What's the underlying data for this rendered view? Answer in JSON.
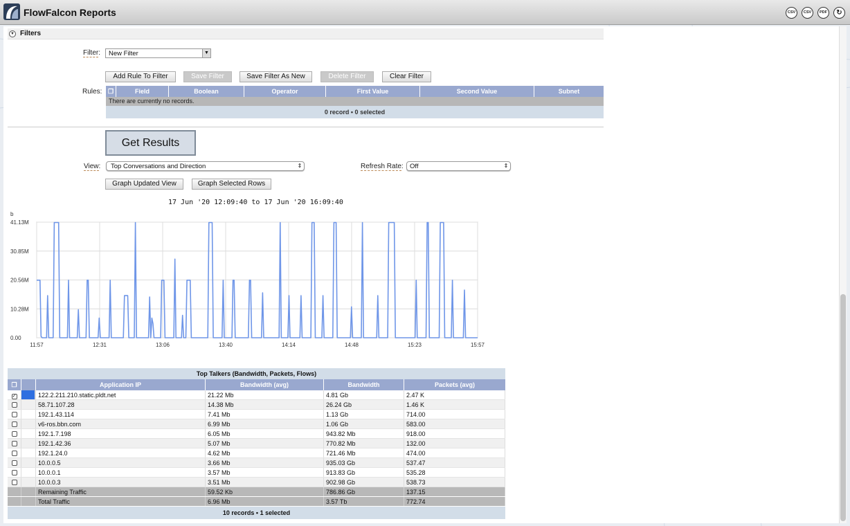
{
  "app": {
    "title": "FlowFalcon Reports",
    "header_icons": [
      {
        "name": "csv-icon",
        "label": "CSV"
      },
      {
        "name": "email-csv-icon",
        "label": "CSV"
      },
      {
        "name": "pdf-icon",
        "label": "PDF"
      },
      {
        "name": "refresh-icon",
        "label": ""
      }
    ]
  },
  "filters": {
    "section_label": "Filters",
    "filter_label": "Filter",
    "filter_value": "New Filter",
    "buttons": {
      "add_rule": "Add Rule To Filter",
      "save": "Save Filter",
      "save_as_new": "Save Filter As New",
      "delete": "Delete Filter",
      "clear": "Clear Filter"
    },
    "rules_label": "Rules:",
    "rules_columns": [
      "Field",
      "Boolean",
      "Operator",
      "First Value",
      "Second Value",
      "Subnet"
    ],
    "no_records": "There are currently no records.",
    "footer": "0 record • 0 selected"
  },
  "controls": {
    "get_results": "Get Results",
    "view_label": "View",
    "view_value": "Top Conversations and Direction",
    "refresh_label": "Refresh Rate",
    "refresh_value": "Off",
    "graph_updated": "Graph Updated View",
    "graph_selected": "Graph Selected Rows"
  },
  "chart_data": {
    "type": "line",
    "title": "17 Jun '20 12:09:40 to 17 Jun '20 16:09:40",
    "ylabel": "b",
    "y_ticks": [
      "0.00",
      "10.28M",
      "20.56M",
      "30.85M",
      "41.13M"
    ],
    "ylim": [
      0,
      41.13
    ],
    "x_ticks": [
      "11:57",
      "12:31",
      "13:06",
      "13:40",
      "14:14",
      "14:48",
      "15:23",
      "15:57"
    ],
    "grid": true,
    "color": "#6f96e8",
    "series": [
      {
        "values": [
          20.5,
          20.5,
          20.5,
          20.5,
          0.5,
          0,
          0,
          0,
          0,
          0,
          15,
          0,
          0,
          0,
          0,
          0,
          41,
          41,
          41,
          41,
          41,
          0,
          0,
          0,
          0,
          0,
          0,
          0,
          0,
          20.5,
          0,
          0,
          0,
          0,
          0,
          0,
          0,
          0,
          10,
          0,
          0,
          0,
          0,
          0,
          0,
          0,
          20.5,
          20.5,
          0,
          0,
          0,
          0,
          0,
          0,
          0,
          0,
          0,
          7,
          0,
          0,
          0,
          0,
          0,
          0,
          0,
          0,
          0,
          20.5,
          0,
          0,
          0,
          0,
          0,
          0,
          0,
          0,
          0,
          0,
          0,
          0,
          15,
          15,
          15,
          15,
          0,
          0,
          0,
          0,
          0,
          0,
          41,
          0,
          0,
          0,
          0,
          0,
          0,
          0,
          0,
          0,
          0,
          0,
          0,
          14.5,
          0,
          7,
          5,
          0,
          0,
          0,
          0,
          0,
          0,
          0,
          20.5,
          20.5,
          20.5,
          0,
          0,
          0,
          0,
          0,
          0,
          0,
          0,
          0,
          28,
          0,
          0,
          0,
          0,
          0,
          0,
          8,
          0,
          0,
          0,
          20.5,
          20.5,
          20.5,
          20.5,
          0,
          0,
          0,
          0,
          0,
          0,
          0,
          0,
          0,
          0,
          0,
          0,
          0,
          0,
          0,
          0,
          41,
          41,
          41,
          41,
          0,
          0,
          0,
          0,
          0,
          0,
          0,
          0,
          0,
          20.5,
          0,
          0,
          0,
          0,
          0,
          0,
          0,
          0,
          20.5,
          20.5,
          0,
          0,
          0,
          0,
          0,
          0,
          0,
          0,
          0,
          0,
          0,
          0,
          0,
          20.5,
          20.5,
          0,
          0,
          0,
          0,
          0,
          0,
          0,
          0,
          0,
          0,
          16,
          0,
          0,
          0,
          0,
          0,
          0,
          0,
          0,
          0,
          0,
          0,
          0,
          0,
          0,
          0,
          41,
          0,
          0,
          0,
          0,
          0,
          0,
          0,
          15,
          0,
          0,
          0,
          0,
          0,
          0,
          0,
          0,
          0,
          0,
          15,
          0,
          0,
          0,
          0,
          0,
          0,
          0,
          0,
          0,
          41,
          41,
          41,
          0,
          0,
          0,
          0,
          0,
          0,
          0,
          15,
          0,
          0,
          0,
          0,
          0,
          0,
          0,
          0,
          0,
          41,
          41,
          41,
          0,
          0,
          0,
          0,
          0,
          0,
          0,
          0,
          0,
          0,
          0,
          0,
          0,
          11,
          0,
          0,
          0,
          0,
          0,
          0,
          0,
          0,
          0,
          41,
          0,
          0,
          0,
          0,
          0,
          0,
          0,
          0,
          0,
          0,
          0,
          0,
          0,
          15,
          0,
          0,
          0,
          0,
          0,
          0,
          0,
          0,
          0,
          41,
          41,
          41,
          41,
          41,
          41,
          0,
          0,
          0,
          0,
          0,
          0,
          0,
          0,
          0,
          0,
          0,
          0,
          0,
          0,
          0,
          0,
          0,
          0,
          0,
          20.5,
          0,
          0,
          0,
          0,
          0,
          0,
          0,
          0,
          0,
          41,
          41,
          0,
          0,
          0,
          0,
          0,
          0,
          0,
          0,
          0,
          0,
          41,
          41,
          41,
          41,
          0,
          0,
          0,
          0,
          0,
          0,
          0,
          20.5,
          0,
          0,
          0,
          0,
          0,
          0,
          0,
          0,
          0,
          0,
          17,
          0,
          0,
          0,
          0,
          0,
          0,
          0,
          0,
          0,
          0,
          0,
          0
        ]
      }
    ]
  },
  "results": {
    "caption": "Top Talkers (Bandwidth, Packets, Flows)",
    "columns": [
      "Application IP",
      "Bandwidth (avg)",
      "Bandwidth",
      "Packets (avg)"
    ],
    "rows": [
      {
        "ip": "122.2.211.210.static.pldt.net",
        "bw_avg": "21.22 Mb",
        "bw": "4.81 Gb",
        "pkts": "2.47 K",
        "checked": true
      },
      {
        "ip": "58.71.107.28",
        "bw_avg": "14.38 Mb",
        "bw": "26.24 Gb",
        "pkts": "1.46 K",
        "checked": false
      },
      {
        "ip": "192.1.43.114",
        "bw_avg": "7.41 Mb",
        "bw": "1.13 Gb",
        "pkts": "714.00",
        "checked": false
      },
      {
        "ip": "v6-ros.bbn.com",
        "bw_avg": "6.99 Mb",
        "bw": "1.06 Gb",
        "pkts": "583.00",
        "checked": false
      },
      {
        "ip": "192.1.7.198",
        "bw_avg": "6.05 Mb",
        "bw": "943.82 Mb",
        "pkts": "918.00",
        "checked": false
      },
      {
        "ip": "192.1.42.36",
        "bw_avg": "5.07 Mb",
        "bw": "770.82 Mb",
        "pkts": "132.00",
        "checked": false
      },
      {
        "ip": "192.1.24.0",
        "bw_avg": "4.62 Mb",
        "bw": "721.46 Mb",
        "pkts": "474.00",
        "checked": false
      },
      {
        "ip": "10.0.0.5",
        "bw_avg": "3.66 Mb",
        "bw": "935.03 Gb",
        "pkts": "537.47",
        "checked": false
      },
      {
        "ip": "10.0.0.1",
        "bw_avg": "3.57 Mb",
        "bw": "913.83 Gb",
        "pkts": "535.28",
        "checked": false
      },
      {
        "ip": "10.0.0.3",
        "bw_avg": "3.51 Mb",
        "bw": "902.98 Gb",
        "pkts": "538.73",
        "checked": false
      }
    ],
    "remaining": {
      "ip": "Remaining Traffic",
      "bw_avg": "59.52 Kb",
      "bw": "786.86 Gb",
      "pkts": "137.15"
    },
    "total": {
      "ip": "Total Traffic",
      "bw_avg": "6.96 Mb",
      "bw": "3.57 Tb",
      "pkts": "772.74"
    },
    "footer": "10 records • 1 selected"
  }
}
